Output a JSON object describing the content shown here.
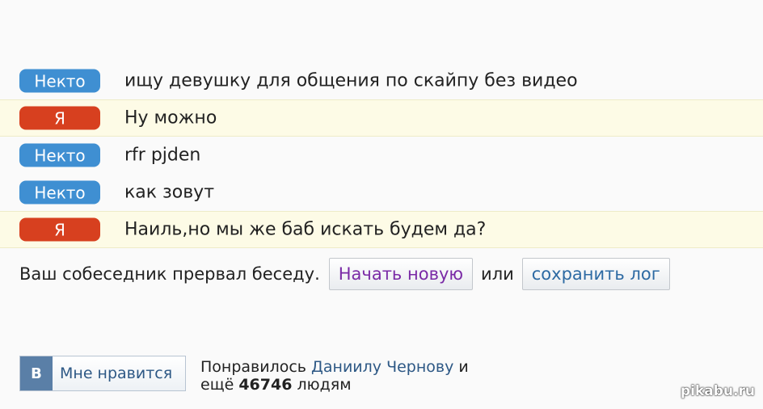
{
  "messages": [
    {
      "sender": "Некто",
      "text": "ищу девушку для общения по скайпу без видео"
    },
    {
      "sender": "Я",
      "text": "Ну можно"
    },
    {
      "sender": "Некто",
      "text": "rfr pjden"
    },
    {
      "sender": "Некто",
      "text": "как зовут"
    },
    {
      "sender": "Я",
      "text": "Наиль,но мы же баб искать будем да?"
    }
  ],
  "status": {
    "ended_text": "Ваш собеседник прервал беседу.",
    "new_chat_button": "Начать новую",
    "or_text": "или",
    "save_log_button": "сохранить лог"
  },
  "vk": {
    "logo": "В",
    "like_label": "Мне нравится",
    "liked_prefix": "Понравилось",
    "liked_name": "Даниилу Чернову",
    "liked_and": "и",
    "liked_more": "ещё",
    "liked_count": "46746",
    "liked_suffix": "людям"
  },
  "watermark": "pikabu.ru",
  "colors": {
    "stranger_badge": "#3f8fd2",
    "me_badge": "#d7401f",
    "me_row_bg": "#fdfbe6",
    "vk_blue": "#5a7fa7"
  }
}
